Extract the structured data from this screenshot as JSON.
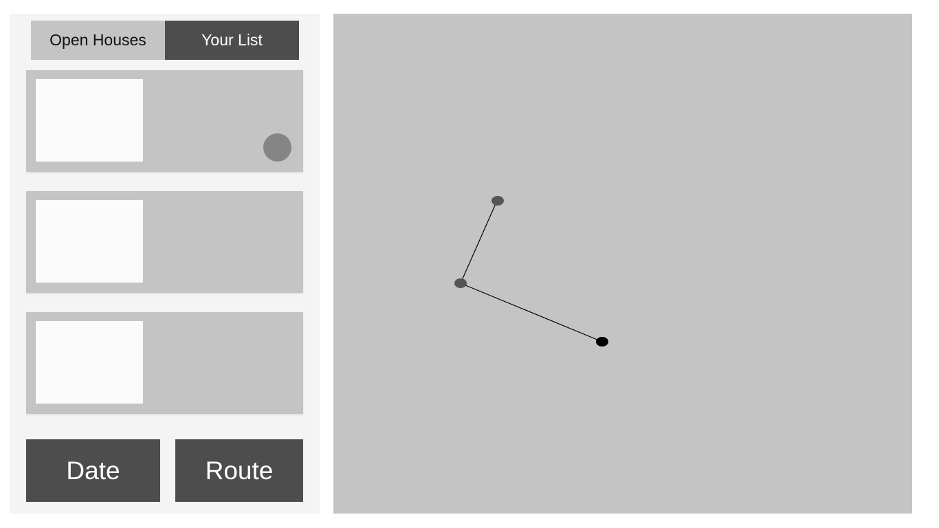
{
  "tabs": {
    "open_houses": "Open Houses",
    "your_list": "Your List",
    "active": "your_list"
  },
  "listings": [
    {
      "favorite_marker": true
    },
    {
      "favorite_marker": false
    },
    {
      "favorite_marker": false
    }
  ],
  "actions": {
    "date_label": "Date",
    "route_label": "Route"
  },
  "colors": {
    "sidebar_bg": "#f4f4f4",
    "panel_gray": "#c4c4c4",
    "dark": "#4d4d4d",
    "thumb": "#fbfbfb",
    "favorite_dot": "#858585",
    "waypoint": "#555555",
    "destination": "#000000"
  },
  "route": {
    "stop_count": 3
  }
}
